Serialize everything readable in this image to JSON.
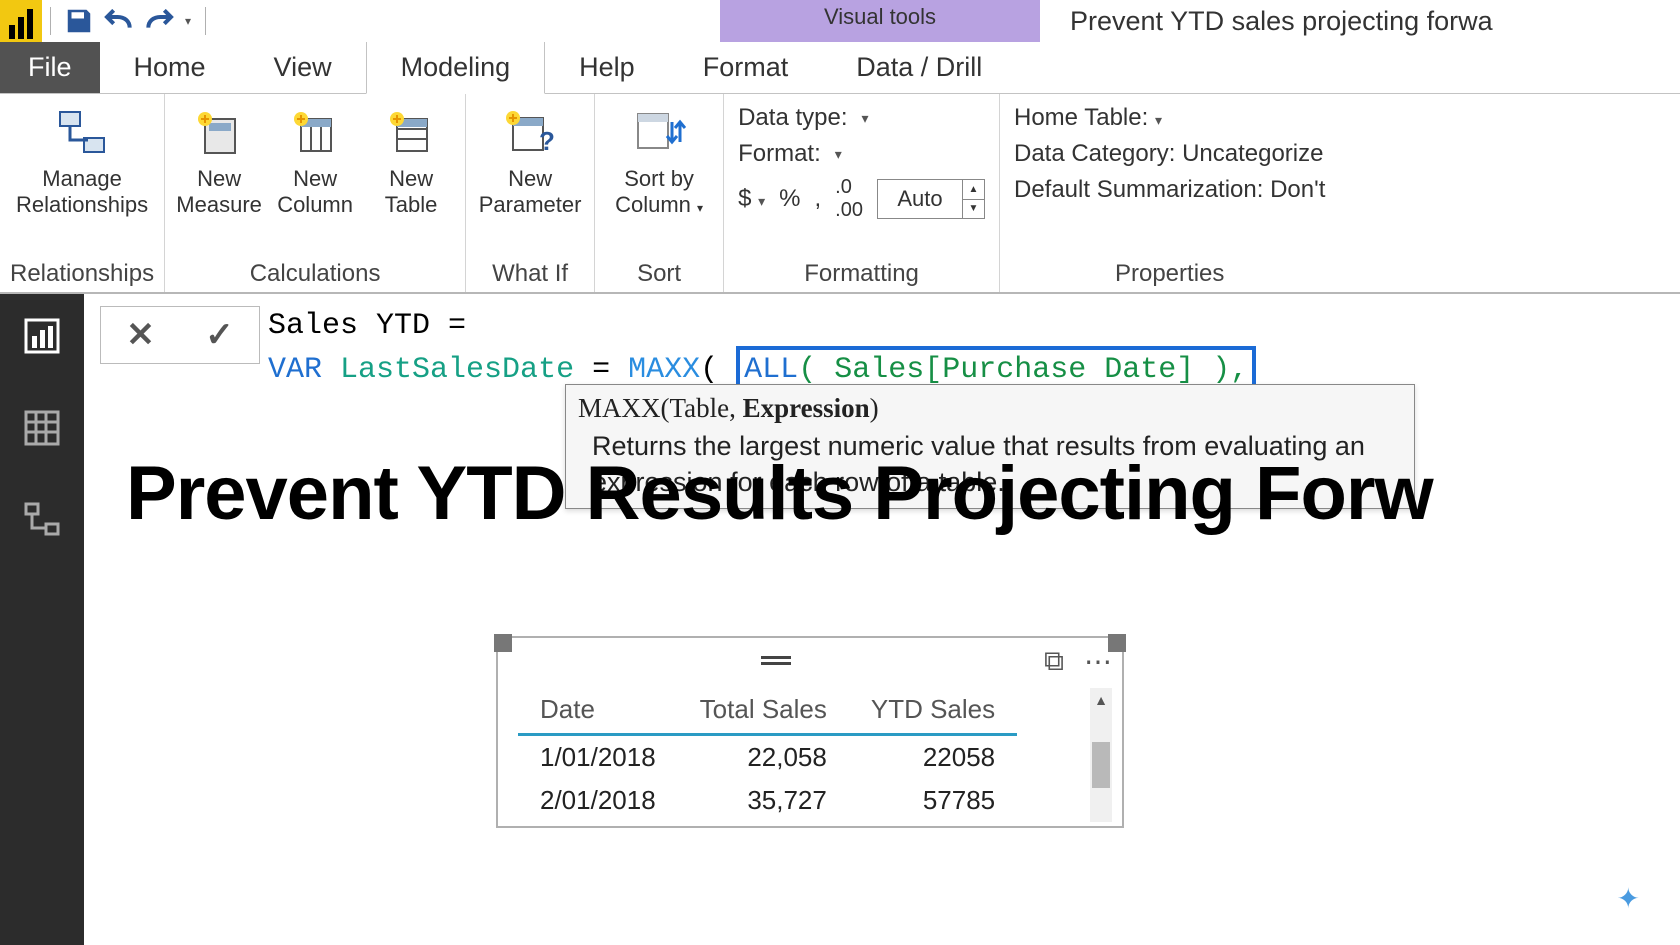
{
  "contextual_tab": "Visual tools",
  "document_title": "Prevent YTD sales projecting forwa",
  "tabs": {
    "file": "File",
    "home": "Home",
    "view": "View",
    "modeling": "Modeling",
    "help": "Help",
    "format": "Format",
    "data_drill": "Data / Drill"
  },
  "ribbon": {
    "relationships": {
      "manage": "Manage\nRelationships",
      "group": "Relationships"
    },
    "calculations": {
      "new_measure": "New\nMeasure",
      "new_column": "New\nColumn",
      "new_table": "New\nTable",
      "group": "Calculations"
    },
    "whatif": {
      "new_parameter": "New\nParameter",
      "group": "What If"
    },
    "sort": {
      "sort_by": "Sort by\nColumn",
      "group": "Sort"
    },
    "formatting": {
      "data_type": "Data type:",
      "format": "Format:",
      "dollar": "$",
      "percent": "%",
      "comma": ",",
      "decimals": ".00",
      "auto": "Auto",
      "group": "Formatting"
    },
    "properties": {
      "home_table": "Home Table:",
      "data_category": "Data Category: Uncategorize",
      "default_sum": "Default Summarization: Don't",
      "group": "Properties"
    }
  },
  "formula": {
    "line1": "Sales YTD =",
    "var_kw": "VAR",
    "var_name": "LastSalesDate",
    "eq": "=",
    "maxx": "MAXX",
    "open": "(",
    "all": "ALL",
    "all_args": "( Sales[Purchase Date] ),"
  },
  "tooltip": {
    "sig_pre": "MAXX(Table, ",
    "sig_bold": "Expression",
    "sig_post": ")",
    "desc": "Returns the largest numeric value that results from evaluating an expression for each row of a table."
  },
  "report_title": "Prevent YTD Results Projecting Forw",
  "table": {
    "columns": [
      "Date",
      "Total Sales",
      "YTD Sales"
    ],
    "rows": [
      [
        "1/01/2018",
        "22,058",
        "22058"
      ],
      [
        "2/01/2018",
        "35,727",
        "57785"
      ]
    ]
  }
}
